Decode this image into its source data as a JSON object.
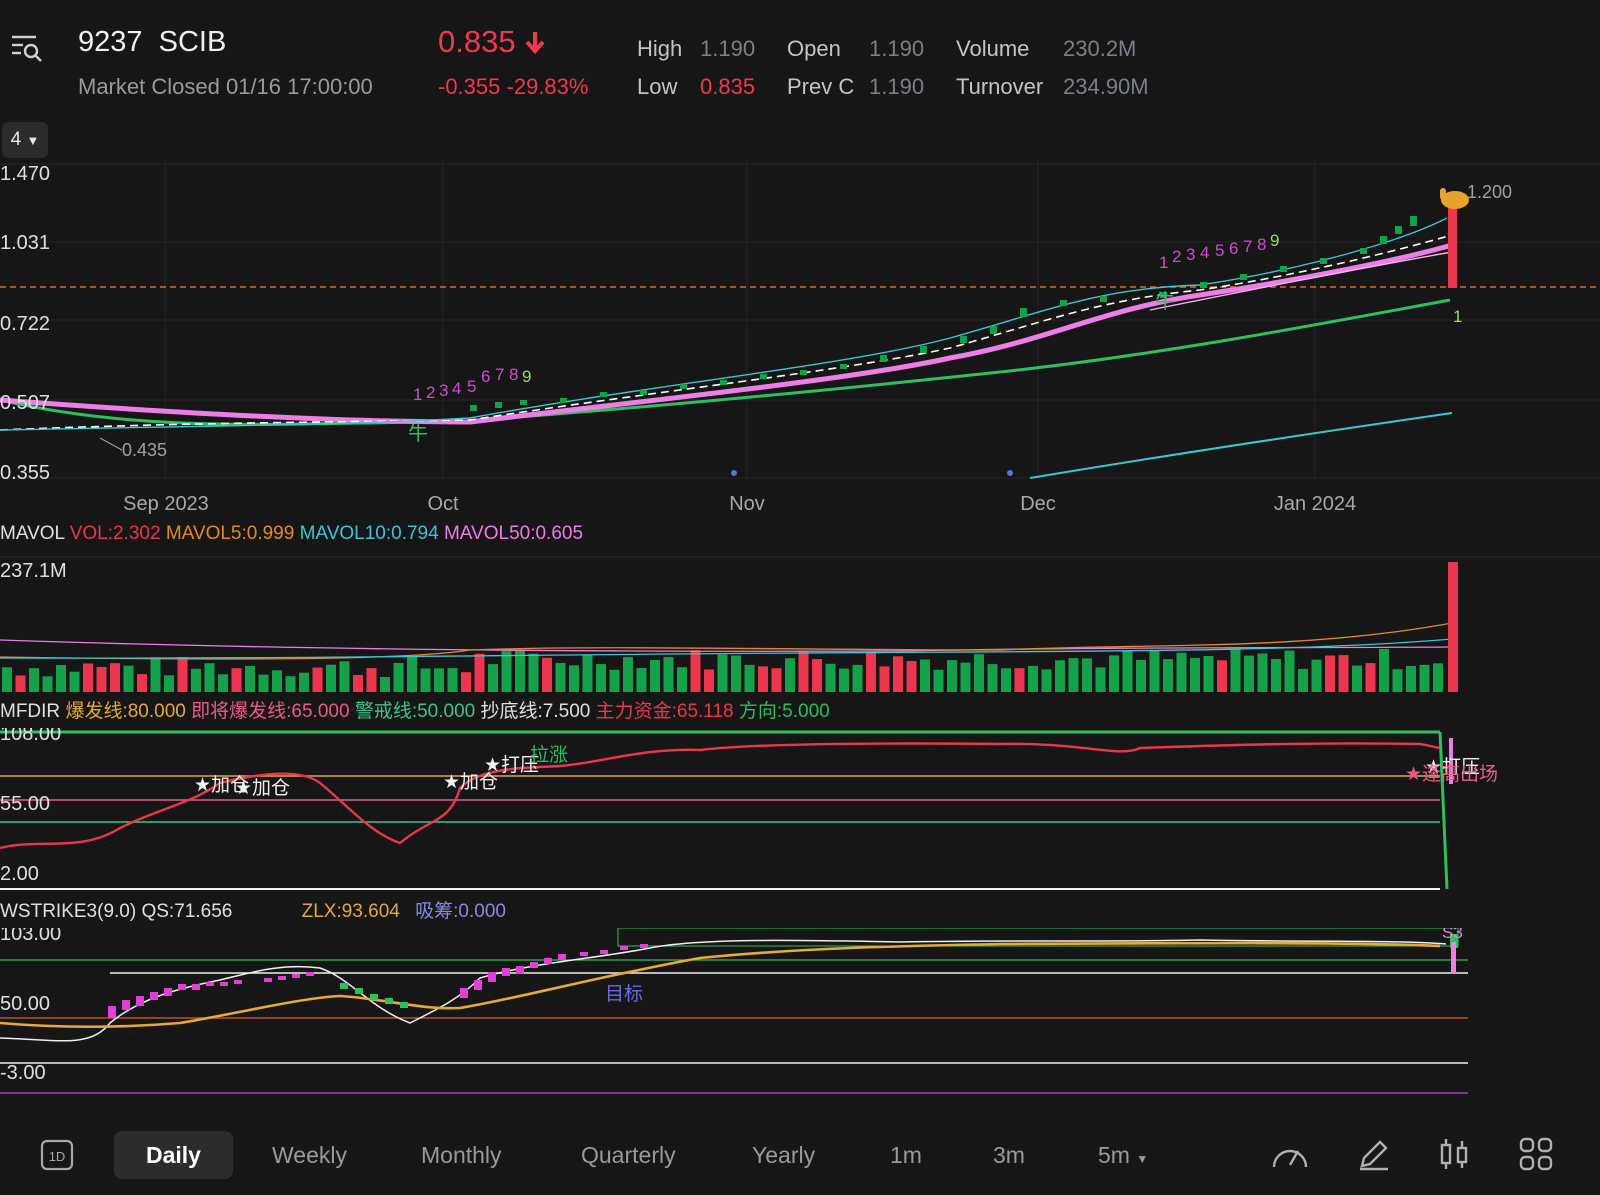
{
  "header": {
    "code": "9237",
    "name": "SCIB",
    "status": "Market Closed",
    "datetime": "01/16 17:00:00",
    "price": "0.835",
    "change": "-0.355",
    "change_pct": "-29.83%",
    "stats": {
      "high_label": "High",
      "high": "1.190",
      "open_label": "Open",
      "open": "1.190",
      "volume_label": "Volume",
      "volume": "230.2M",
      "low_label": "Low",
      "low": "0.835",
      "prevc_label": "Prev C",
      "prevc": "1.190",
      "turnover_label": "Turnover",
      "turnover": "234.90M"
    },
    "layout_select": "4"
  },
  "price_chart": {
    "yticks": [
      "1.470",
      "1.031",
      "0.722",
      "0.507",
      "0.355"
    ],
    "xticks": [
      "Sep 2023",
      "Oct",
      "Nov",
      "Dec",
      "Jan 2024"
    ],
    "high_annotation": "1.200",
    "low_annotation": "0.435",
    "count_seq1": [
      "1",
      "2",
      "3",
      "4",
      "5",
      "6",
      "7",
      "8",
      "9"
    ],
    "count_seq2": [
      "1",
      "2",
      "3",
      "4",
      "5",
      "6",
      "7",
      "8",
      "9"
    ],
    "marker_1": "1",
    "marker_niu": "牛"
  },
  "mavol": {
    "title": "MAVOL",
    "vol": "VOL:2.302",
    "ma5": "MAVOL5:0.999",
    "ma10": "MAVOL10:0.794",
    "ma50": "MAVOL50:0.605",
    "ymax": "237.1M"
  },
  "mfdir": {
    "title": "MFDIR",
    "l1": "爆发线:80.000",
    "l2": "即将爆发线:65.000",
    "l3": "警戒线:50.000",
    "l4": "抄底线:7.500",
    "l5": "主力资金:65.118",
    "l6": "方向:5.000",
    "yticks": [
      "108.00",
      "55.00",
      "2.00"
    ],
    "ann": {
      "jiacang": "★加仓",
      "dayan": "★打压",
      "lazhang": "拉涨",
      "taogao": "★逢高出场"
    }
  },
  "wstrike": {
    "title": "WSTRIKE3(9.0)",
    "qs": "QS:71.656",
    "zlx": "ZLX:93.604",
    "xichou": "吸筹:0.000",
    "yticks": [
      "103.00",
      "50.00",
      "-3.00"
    ],
    "target": "目标",
    "s3": "S3"
  },
  "tabs": {
    "d1": "1D",
    "items": [
      "Daily",
      "Weekly",
      "Monthly",
      "Quarterly",
      "Yearly",
      "1m",
      "3m",
      "5m"
    ]
  },
  "colors": {
    "up": "#15a14c",
    "down": "#ec3650",
    "pink": "#ec7ee6",
    "green_ma": "#2fbf5e",
    "cyan": "#3cc6d6",
    "orange": "#e58a2b",
    "yellow": "#e5a93c"
  }
}
